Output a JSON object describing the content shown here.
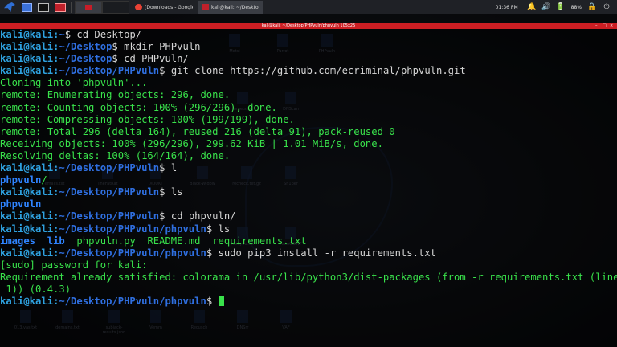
{
  "panel": {
    "launchers": [
      {
        "name": "kali-menu-icon"
      },
      {
        "name": "show-desktop-icon"
      },
      {
        "name": "terminal-launcher-icon"
      },
      {
        "name": "red-app-icon"
      }
    ],
    "tasks": [
      {
        "label": "[Downloads - Google Ch...",
        "icon_color": "#e94235",
        "active": false
      },
      {
        "label": "kali@kali: ~/Desktop/PH...",
        "icon_color": "#c0202a",
        "active": true
      }
    ],
    "clock": "01:36 PM",
    "battery": "88%"
  },
  "window": {
    "title_small": "kali@kali: ~/Desktop/PHPvuln/phpvuln",
    "title": "kali@kali: ~/Desktop/PHPvuln/phpvuln 105x25"
  },
  "desktop": {
    "icons": [
      "Metsi",
      "Parrot",
      "PHPvuln",
      "targets.txt",
      "DNScan",
      "emails.txt",
      "TheFatRat",
      "XOUKI",
      "Black-Widow",
      "recheck.txt.gz",
      "Sn1per",
      "rockyou.txt",
      "AutoOSINT",
      "013.vas.txt",
      "domains.txt",
      "subjack-results.json",
      "Vemm",
      "Recusch",
      "DNSrr",
      "VAF"
    ]
  },
  "terminal": {
    "user": "kali@kali",
    "lines": [
      {
        "path": "~",
        "cmd": "cd Desktop/"
      },
      {
        "path": "~/Desktop",
        "cmd": "mkdir PHPvuln"
      },
      {
        "path": "~/Desktop",
        "cmd": "cd PHPvuln/"
      },
      {
        "path": "~/Desktop/PHPvuln",
        "cmd": "git clone https://github.com/ecriminal/phpvuln.git"
      },
      {
        "out": "Cloning into 'phpvuln'..."
      },
      {
        "out": "remote: Enumerating objects: 296, done."
      },
      {
        "out": "remote: Counting objects: 100% (296/296), done."
      },
      {
        "out": "remote: Compressing objects: 100% (199/199), done."
      },
      {
        "out": "remote: Total 296 (delta 164), reused 216 (delta 91), pack-reused 0"
      },
      {
        "out": "Receiving objects: 100% (296/296), 299.62 KiB | 1.01 MiB/s, done."
      },
      {
        "out": "Resolving deltas: 100% (164/164), done."
      },
      {
        "path": "~/Desktop/PHPvuln",
        "cmd": "l"
      },
      {
        "dir": "phpvuln",
        "suffix": "/"
      },
      {
        "path": "~/Desktop/PHPvuln",
        "cmd": "ls"
      },
      {
        "dir": "phpvuln",
        "suffix": ""
      },
      {
        "path": "~/Desktop/PHPvuln",
        "cmd": "cd phpvuln/"
      },
      {
        "path": "~/Desktop/PHPvuln/phpvuln",
        "cmd": "ls"
      },
      {
        "listing": [
          {
            "t": "images",
            "dir": true
          },
          {
            "t": "  "
          },
          {
            "t": "lib",
            "dir": true
          },
          {
            "t": "  phpvuln.py  README.md  requirements.txt"
          }
        ]
      },
      {
        "path": "~/Desktop/PHPvuln/phpvuln",
        "cmd": "sudo pip3 install -r requirements.txt"
      },
      {
        "out": "[sudo] password for kali:"
      },
      {
        "out": "Requirement already satisfied: colorama in /usr/lib/python3/dist-packages (from -r requirements.txt (line"
      },
      {
        "out": " 1)) (0.4.3)"
      },
      {
        "path": "~/Desktop/PHPvuln/phpvuln",
        "cmd": "",
        "cursor": true
      }
    ]
  },
  "colors": {
    "output_green": "#39e24b",
    "prompt_user": "#2fa2e0",
    "prompt_path": "#2f6fe0",
    "titlebar_red": "#cc1e23"
  }
}
